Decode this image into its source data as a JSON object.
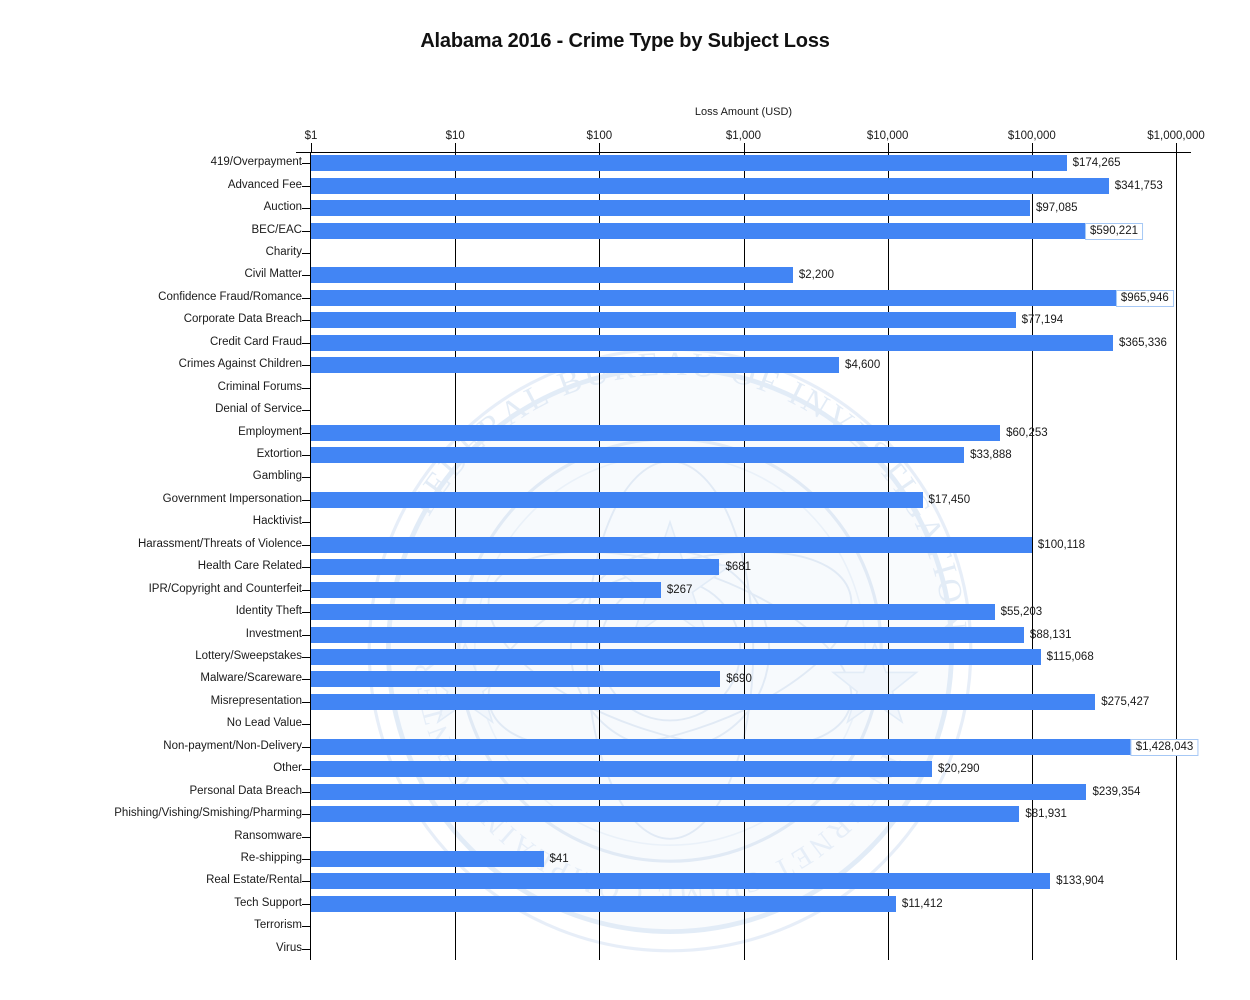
{
  "chart_data": {
    "type": "bar",
    "orientation": "horizontal",
    "title": "Alabama 2016 - Crime Type by Subject Loss",
    "xlabel": "Loss Amount (USD)",
    "ylabel": "",
    "scale": "log",
    "xlim": [
      1,
      1000000
    ],
    "grid": true,
    "legend": null,
    "xticks": [
      "$1",
      "$10",
      "$100",
      "$1,000",
      "$10,000",
      "$100,000",
      "$1,000,000"
    ],
    "xtick_values": [
      1,
      10,
      100,
      1000,
      10000,
      100000,
      1000000
    ],
    "bar_color": "#4285f4",
    "categories": [
      "419/Overpayment",
      "Advanced Fee",
      "Auction",
      "BEC/EAC",
      "Charity",
      "Civil Matter",
      "Confidence Fraud/Romance",
      "Corporate Data Breach",
      "Credit Card Fraud",
      "Crimes Against Children",
      "Criminal Forums",
      "Denial of Service",
      "Employment",
      "Extortion",
      "Gambling",
      "Government Impersonation",
      "Hacktivist",
      "Harassment/Threats of Violence",
      "Health Care Related",
      "IPR/Copyright and Counterfeit",
      "Identity Theft",
      "Investment",
      "Lottery/Sweepstakes",
      "Malware/Scareware",
      "Misrepresentation",
      "No Lead Value",
      "Non-payment/Non-Delivery",
      "Other",
      "Personal Data Breach",
      "Phishing/Vishing/Smishing/Pharming",
      "Ransomware",
      "Re-shipping",
      "Real Estate/Rental",
      "Tech Support",
      "Terrorism",
      "Virus"
    ],
    "values": [
      174265,
      341753,
      97085,
      590221,
      null,
      2200,
      965946,
      77194,
      365336,
      4600,
      null,
      null,
      60253,
      33888,
      null,
      17450,
      null,
      100118,
      681,
      267,
      55203,
      88131,
      115068,
      690,
      275427,
      null,
      1428043,
      20290,
      239354,
      81931,
      null,
      41,
      133904,
      11412,
      null,
      null
    ],
    "value_labels": [
      "$174,265",
      "$341,753",
      "$97,085",
      "$590,221",
      "",
      "$2,200",
      "$965,946",
      "$77,194",
      "$365,336",
      "$4,600",
      "",
      "",
      "$60,253",
      "$33,888",
      "",
      "$17,450",
      "",
      "$100,118",
      "$681",
      "$267",
      "$55,203",
      "$88,131",
      "$115,068",
      "$690",
      "$275,427",
      "",
      "$1,428,043",
      "$20,290",
      "$239,354",
      "$81,931",
      "",
      "$41",
      "$133,904",
      "$11,412",
      "",
      ""
    ],
    "boxed_labels": [
      false,
      false,
      false,
      true,
      false,
      false,
      true,
      false,
      false,
      false,
      false,
      false,
      false,
      false,
      false,
      false,
      false,
      false,
      false,
      false,
      false,
      false,
      false,
      false,
      false,
      false,
      true,
      false,
      false,
      false,
      false,
      false,
      false,
      false,
      false,
      false
    ]
  },
  "watermark": {
    "outer_text": "FEDERAL BUREAU OF INVESTIGATION",
    "inner_text": "INTERNET CRIME COMPLAINT CENTER"
  }
}
